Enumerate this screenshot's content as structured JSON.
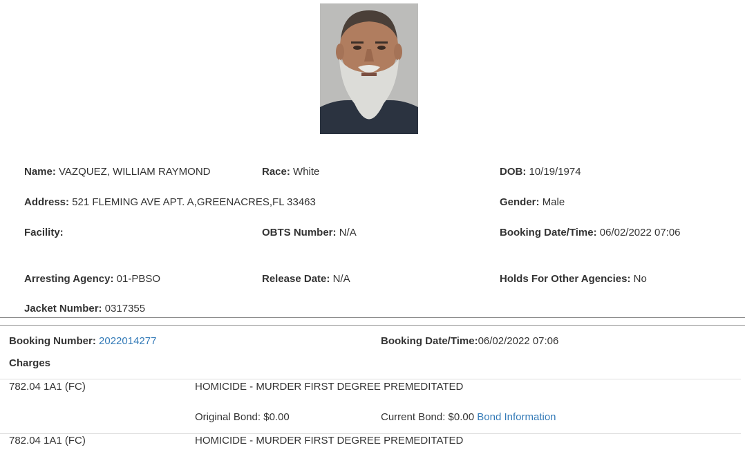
{
  "inmate": {
    "photo_icon": "mugshot-photo",
    "name_label": "Name:",
    "name": "VAZQUEZ, WILLIAM RAYMOND",
    "race_label": "Race:",
    "race": "White",
    "dob_label": "DOB:",
    "dob": "10/19/1974",
    "address_label": "Address:",
    "address": "521 FLEMING AVE APT. A,GREENACRES,FL 33463",
    "gender_label": "Gender:",
    "gender": "Male",
    "facility_label": "Facility:",
    "facility": "",
    "obts_label": "OBTS Number:",
    "obts": "N/A",
    "booking_dt_label": "Booking Date/Time:",
    "booking_dt": "06/02/2022 07:06",
    "agency_label": "Arresting Agency:",
    "agency": "01-PBSO",
    "release_label": "Release Date:",
    "release": "N/A",
    "holds_label": "Holds For Other Agencies:",
    "holds": "No",
    "jacket_label": "Jacket Number:",
    "jacket": "0317355"
  },
  "booking": {
    "number_label": "Booking Number:",
    "number": "2022014277",
    "datetime_label": "Booking Date/Time:",
    "datetime": "06/02/2022 07:06",
    "charges_heading": "Charges"
  },
  "charges": [
    {
      "statute": "782.04 1A1 (FC)",
      "description": "HOMICIDE - MURDER FIRST DEGREE PREMEDITATED",
      "original_bond": "Original Bond: $0.00",
      "current_bond": "Current Bond: $0.00",
      "bond_link": "Bond Information"
    },
    {
      "statute": "782.04 1A1 (FC)",
      "description": "HOMICIDE - MURDER FIRST DEGREE PREMEDITATED"
    }
  ],
  "colors": {
    "link": "#337ab7",
    "text": "#333333",
    "rule": "#8a8a8a"
  }
}
